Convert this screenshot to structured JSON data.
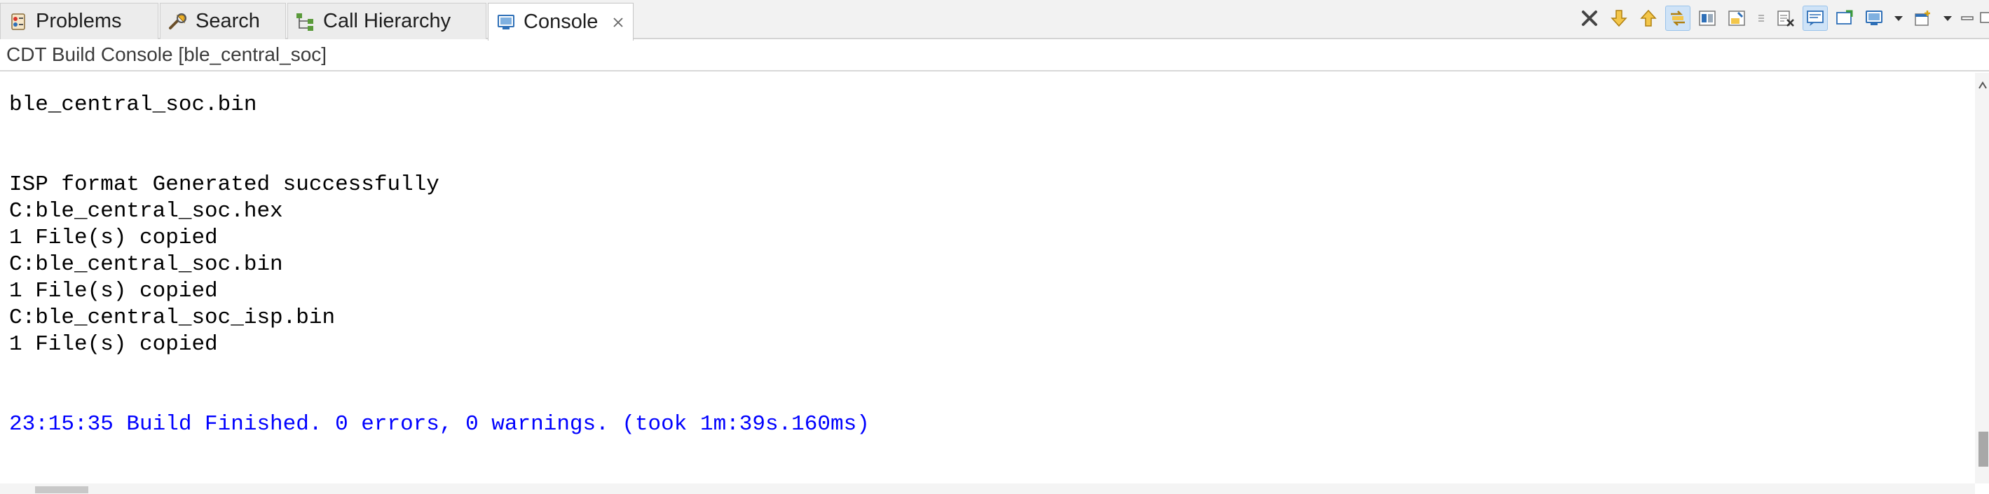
{
  "tabs": [
    {
      "label": "Problems",
      "icon": "problems-icon"
    },
    {
      "label": "Search",
      "icon": "search-icon"
    },
    {
      "label": "Call Hierarchy",
      "icon": "call-hierarchy-icon"
    },
    {
      "label": "Console",
      "icon": "console-icon",
      "active": true
    }
  ],
  "console": {
    "title": "CDT Build Console [ble_central_soc]",
    "lines": [
      "ble_central_soc.bin",
      "ISP format Generated successfully",
      "C:ble_central_soc.hex",
      "1 File(s) copied",
      "C:ble_central_soc.bin",
      "1 File(s) copied",
      "C:ble_central_soc_isp.bin",
      "1 File(s) copied"
    ],
    "status_line": "23:15:35 Build Finished. 0 errors, 0 warnings. (took 1m:39s.160ms)"
  },
  "toolbar": [
    "terminate-icon",
    "scroll-down-icon",
    "scroll-up-icon",
    "link-icon",
    "display-selected-icon",
    "pin-console-icon",
    "remove-launches-icon",
    "clear-console-icon",
    "word-wrap-icon",
    "open-console-icon",
    "display-console-icon",
    "dropdown-icon",
    "new-console-icon",
    "dropdown-icon",
    "minimize-icon",
    "maximize-icon"
  ],
  "colors": {
    "status_text": "#0000ff",
    "console_text": "#000000",
    "accent": "#2e6fb7"
  }
}
